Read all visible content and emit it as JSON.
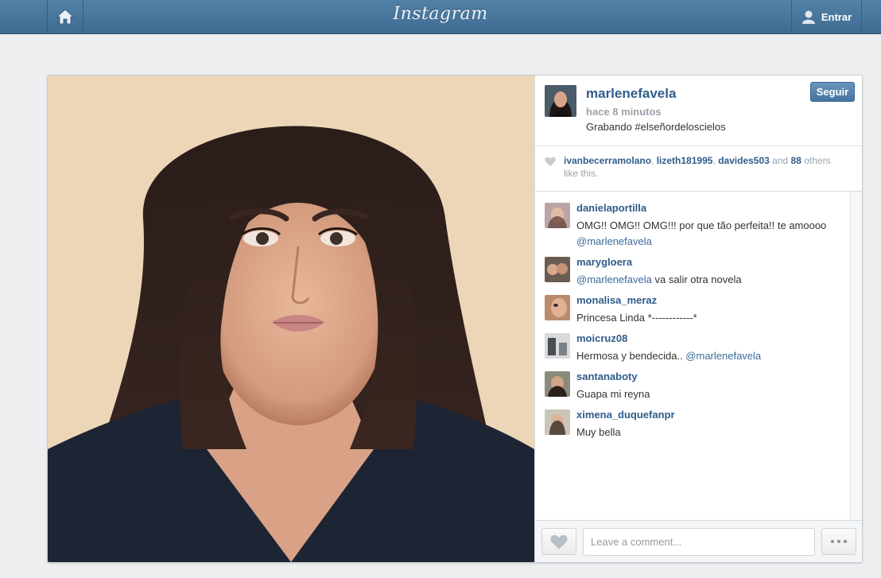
{
  "topbar": {
    "logo": "Instagram",
    "login_label": "Entrar",
    "icons": {
      "home": "home-icon",
      "user": "user-icon"
    }
  },
  "post": {
    "owner": {
      "username": "marlenefavela",
      "time": "hace 8 minutos",
      "caption": "Grabando #elseñordeloscielos",
      "follow_label": "Seguir"
    },
    "likes": {
      "users": [
        "ivanbecerramolano",
        "lizeth181995",
        "davides503"
      ],
      "and": "and",
      "count": "88",
      "suffix": "others like this."
    },
    "comments": [
      {
        "user": "danielaportilla",
        "text": "OMG!! OMG!! OMG!!! por que tão perfeita!! te amoooo",
        "mention": "@marlenefavela",
        "mention_position": "newline"
      },
      {
        "user": "marygloera",
        "mention": "@marlenefavela",
        "text": "va salir otra novela",
        "mention_position": "before"
      },
      {
        "user": "monalisa_meraz",
        "text": "Princesa Linda *------------*"
      },
      {
        "user": "moicruz08",
        "text": "Hermosa y bendecida.. ",
        "mention": "@marlenefavela",
        "mention_position": "after"
      },
      {
        "user": "santanaboty",
        "text": "Guapa mi reyna"
      },
      {
        "user": "ximena_duquefanpr",
        "text": "Muy bella"
      }
    ],
    "composer": {
      "placeholder": "Leave a comment..."
    }
  },
  "colors": {
    "topbar": "#3e6b92",
    "link": "#2f5d8a",
    "background": "#eceeef"
  }
}
